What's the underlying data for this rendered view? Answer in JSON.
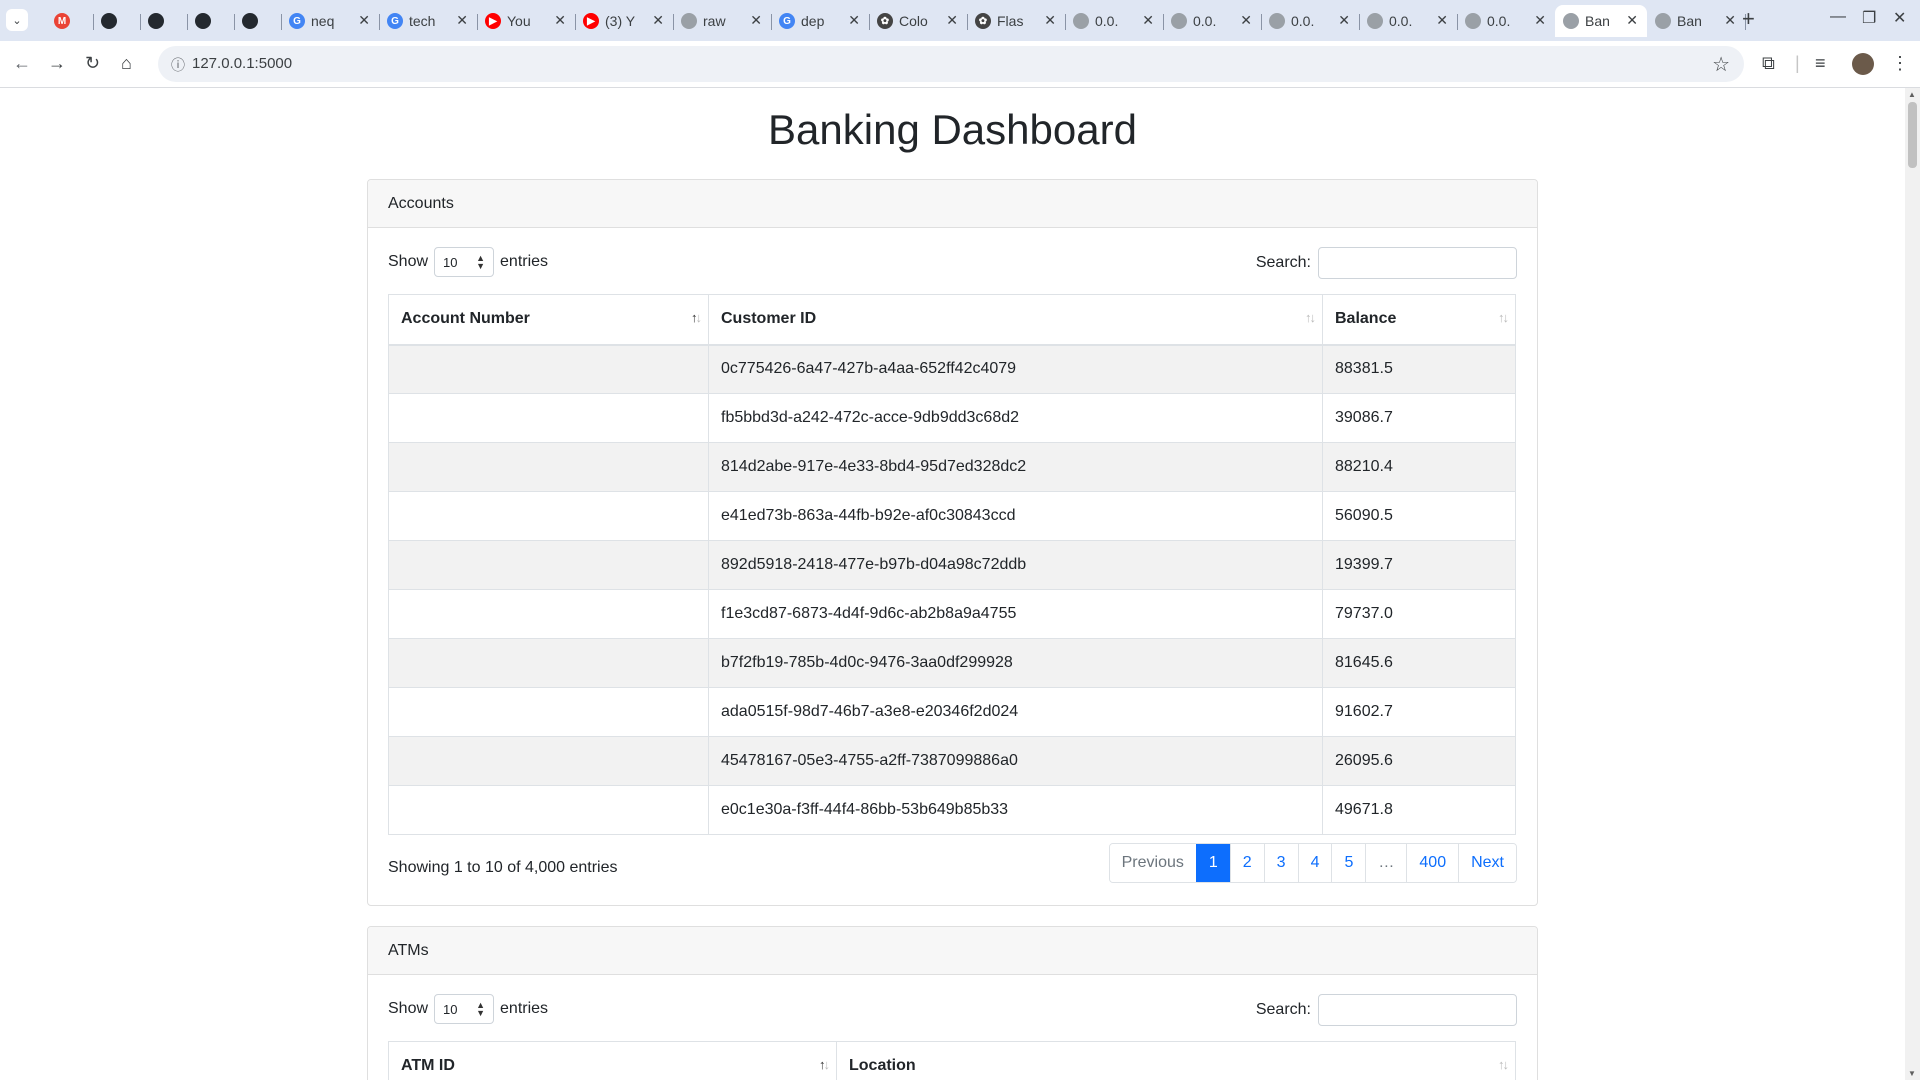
{
  "browser": {
    "tabs": [
      {
        "title": "",
        "favicon": "gmail-icon",
        "color": "#ea4335",
        "letter": "M",
        "size": "short"
      },
      {
        "title": "",
        "favicon": "github-icon",
        "color": "#24292f",
        "letter": "",
        "size": "short"
      },
      {
        "title": "",
        "favicon": "github-icon",
        "color": "#24292f",
        "letter": "",
        "size": "short"
      },
      {
        "title": "",
        "favicon": "github-icon",
        "color": "#24292f",
        "letter": "",
        "size": "short"
      },
      {
        "title": "",
        "favicon": "github-icon",
        "color": "#24292f",
        "letter": "",
        "size": "short"
      },
      {
        "title": "neq",
        "favicon": "google-icon",
        "color": "#4285f4",
        "letter": "G",
        "size": "norm"
      },
      {
        "title": "tech",
        "favicon": "google-icon",
        "color": "#4285f4",
        "letter": "G",
        "size": "norm"
      },
      {
        "title": "You",
        "favicon": "youtube-icon",
        "color": "#ff0000",
        "letter": "▶",
        "size": "norm"
      },
      {
        "title": "(3) Y",
        "favicon": "youtube-icon",
        "color": "#ff0000",
        "letter": "▶",
        "size": "norm"
      },
      {
        "title": "raw",
        "favicon": "globe-icon",
        "color": "#9aa0a6",
        "letter": "",
        "size": "norm"
      },
      {
        "title": "dep",
        "favicon": "google-icon",
        "color": "#4285f4",
        "letter": "G",
        "size": "norm"
      },
      {
        "title": "Colo",
        "favicon": "openai-icon",
        "color": "#444444",
        "letter": "✿",
        "size": "norm"
      },
      {
        "title": "Flas",
        "favicon": "openai-icon",
        "color": "#444444",
        "letter": "✿",
        "size": "norm"
      },
      {
        "title": "0.0.",
        "favicon": "globe-icon",
        "color": "#9aa0a6",
        "letter": "",
        "size": "norm"
      },
      {
        "title": "0.0.",
        "favicon": "globe-icon",
        "color": "#9aa0a6",
        "letter": "",
        "size": "norm"
      },
      {
        "title": "0.0.",
        "favicon": "globe-icon",
        "color": "#9aa0a6",
        "letter": "",
        "size": "norm"
      },
      {
        "title": "0.0.",
        "favicon": "globe-icon",
        "color": "#9aa0a6",
        "letter": "",
        "size": "norm"
      },
      {
        "title": "0.0.",
        "favicon": "globe-icon",
        "color": "#9aa0a6",
        "letter": "",
        "size": "norm"
      },
      {
        "title": "Ban",
        "favicon": "globe-icon",
        "color": "#9aa0a6",
        "letter": "",
        "size": "active"
      },
      {
        "title": "Ban",
        "favicon": "globe-icon",
        "color": "#9aa0a6",
        "letter": "",
        "size": "norm"
      }
    ],
    "new_tab": "+",
    "url": "127.0.0.1:5000"
  },
  "page": {
    "title": "Banking Dashboard"
  },
  "accounts": {
    "header": "Accounts",
    "show_label": "Show",
    "entries_label": "entries",
    "page_length": "10",
    "search_label": "Search:",
    "columns": [
      "Account Number",
      "Customer ID",
      "Balance"
    ],
    "rows": [
      {
        "account_number": "",
        "customer_id": "0c775426-6a47-427b-a4aa-652ff42c4079",
        "balance": "88381.5"
      },
      {
        "account_number": "",
        "customer_id": "fb5bbd3d-a242-472c-acce-9db9dd3c68d2",
        "balance": "39086.7"
      },
      {
        "account_number": "",
        "customer_id": "814d2abe-917e-4e33-8bd4-95d7ed328dc2",
        "balance": "88210.4"
      },
      {
        "account_number": "",
        "customer_id": "e41ed73b-863a-44fb-b92e-af0c30843ccd",
        "balance": "56090.5"
      },
      {
        "account_number": "",
        "customer_id": "892d5918-2418-477e-b97b-d04a98c72ddb",
        "balance": "19399.7"
      },
      {
        "account_number": "",
        "customer_id": "f1e3cd87-6873-4d4f-9d6c-ab2b8a9a4755",
        "balance": "79737.0"
      },
      {
        "account_number": "",
        "customer_id": "b7f2fb19-785b-4d0c-9476-3aa0df299928",
        "balance": "81645.6"
      },
      {
        "account_number": "",
        "customer_id": "ada0515f-98d7-46b7-a3e8-e20346f2d024",
        "balance": "91602.7"
      },
      {
        "account_number": "",
        "customer_id": "45478167-05e3-4755-a2ff-7387099886a0",
        "balance": "26095.6"
      },
      {
        "account_number": "",
        "customer_id": "e0c1e30a-f3ff-44f4-86bb-53b649b85b33",
        "balance": "49671.8"
      }
    ],
    "info": "Showing 1 to 10 of 4,000 entries",
    "pagination": [
      "Previous",
      "1",
      "2",
      "3",
      "4",
      "5",
      "…",
      "400",
      "Next"
    ],
    "active_page": "1"
  },
  "atms": {
    "header": "ATMs",
    "show_label": "Show",
    "entries_label": "entries",
    "page_length": "10",
    "search_label": "Search:",
    "columns": [
      "ATM ID",
      "Location"
    ]
  },
  "colors": {
    "accent": "#0d6efd",
    "tabbar": "#dfe6f3",
    "striped_row": "#f2f2f2"
  }
}
